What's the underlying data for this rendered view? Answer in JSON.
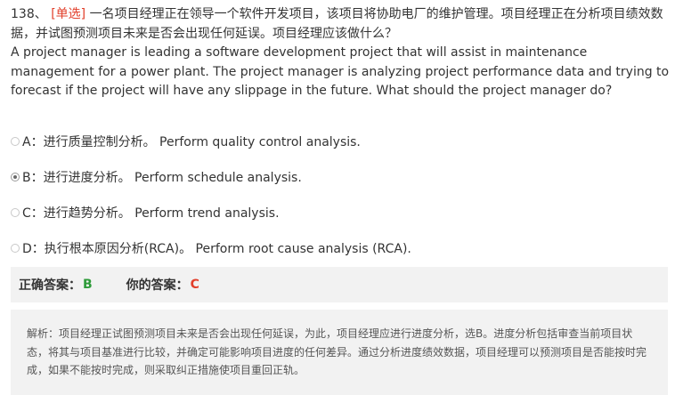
{
  "question": {
    "number": "138、",
    "type_tag": "[单选]",
    "text_cn": "一名项目经理正在领导一个软件开发项目，该项目将协助电厂的维护管理。项目经理正在分析项目绩效数据，并试图预测项目未来是否会出现任何延误。项目经理应该做什么？",
    "text_en": "A project manager is leading a software development project that will assist in maintenance management for a power plant. The project manager is analyzing project performance data and trying to forecast if the project will have any slippage in the future. What should the project manager do?"
  },
  "options": [
    {
      "key": "A",
      "label": "A：进行质量控制分析。 Perform quality control analysis.",
      "selected": false
    },
    {
      "key": "B",
      "label": "B：进行进度分析。 Perform schedule analysis.",
      "selected": true
    },
    {
      "key": "C",
      "label": "C：进行趋势分析。 Perform trend analysis.",
      "selected": false
    },
    {
      "key": "D",
      "label": "D：执行根本原因分析(RCA)。 Perform root cause analysis (RCA).",
      "selected": false
    }
  ],
  "answer": {
    "correct_label": "正确答案：",
    "correct_value": "B",
    "your_label": "你的答案：",
    "your_value": "C"
  },
  "explanation": "解析：项目经理正试图预测项目未来是否会出现任何延误，为此，项目经理应进行进度分析，选B。进度分析包括审查当前项目状态，将其与项目基准进行比较，并确定可能影响项目进度的任何差异。通过分析进度绩效数据，项目经理可以预测项目是否能按时完成，如果不能按时完成，则采取纠正措施使项目重回正轨。",
  "colors": {
    "tag": "#e2402c",
    "correct": "#2e9b3a",
    "wrong": "#e2402c",
    "panel_bg": "#f2f2f2"
  }
}
